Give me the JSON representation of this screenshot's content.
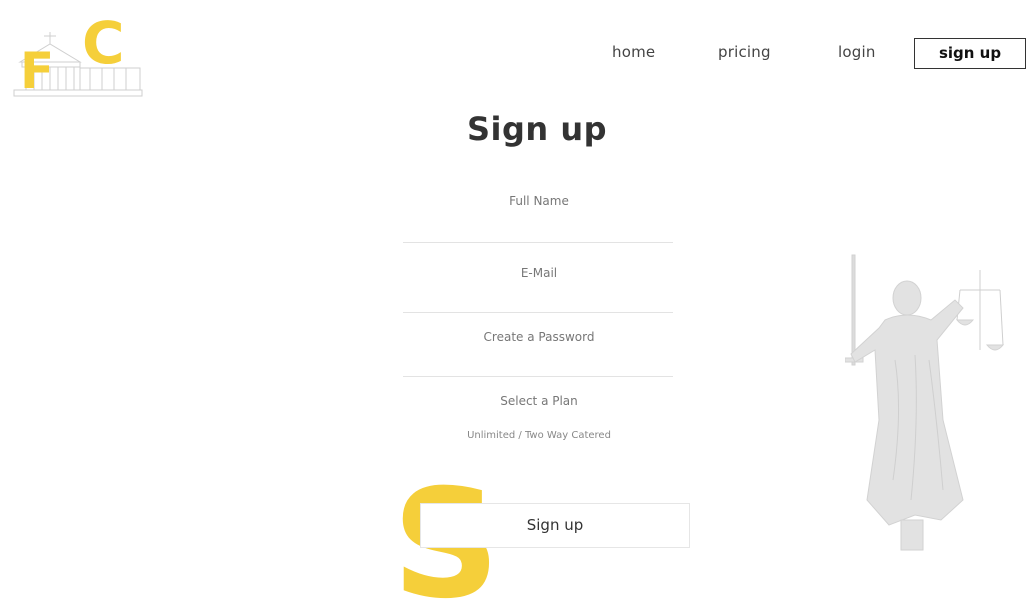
{
  "brand": {
    "letter_f": "F",
    "letter_c": "C",
    "accent_color": "#f5cf3a",
    "logo_icon": "courthouse-icon"
  },
  "nav": {
    "home": "home",
    "pricing": "pricing",
    "login": "login",
    "signup": "sign up"
  },
  "page": {
    "title": "Sign up"
  },
  "form": {
    "fullname_placeholder": "Full Name",
    "email_placeholder": "E-Mail",
    "password_placeholder": "Create a Password",
    "plan_label": "Select a Plan",
    "plan_value": "Unlimited / Two Way Catered",
    "submit_label": "Sign up"
  },
  "decor": {
    "big_letter": "S",
    "statue_icon": "lady-justice-icon"
  }
}
